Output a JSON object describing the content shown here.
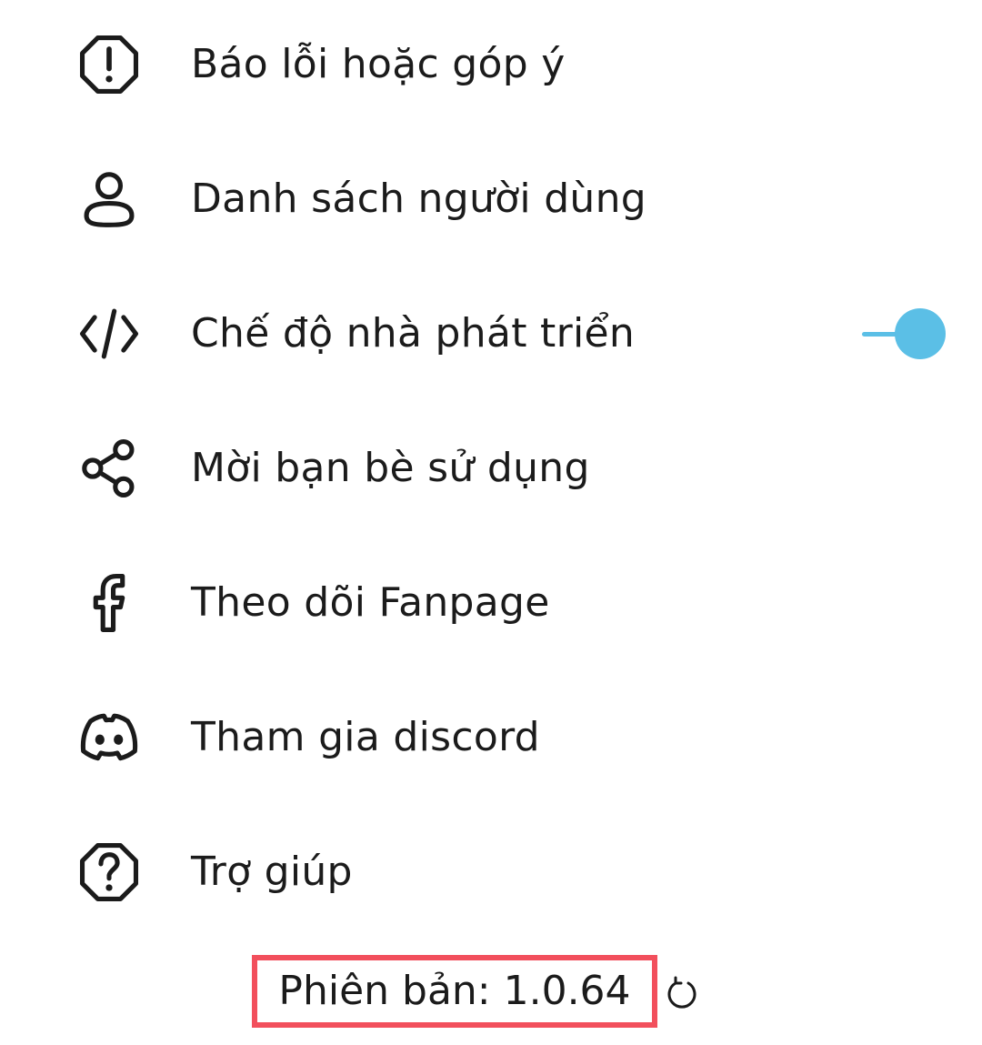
{
  "menu": {
    "items": [
      {
        "label": "Báo lỗi hoặc góp ý",
        "icon": "report-issue-icon"
      },
      {
        "label": "Danh sách người dùng",
        "icon": "user-icon"
      },
      {
        "label": "Chế độ nhà phát triển",
        "icon": "code-icon",
        "toggle_on": true
      },
      {
        "label": "Mời bạn bè sử dụng",
        "icon": "share-icon"
      },
      {
        "label": "Theo dõi Fanpage",
        "icon": "facebook-icon"
      },
      {
        "label": "Tham gia discord",
        "icon": "discord-icon"
      },
      {
        "label": "Trợ giúp",
        "icon": "help-icon"
      }
    ]
  },
  "footer": {
    "version_text": "Phiên bản: 1.0.64",
    "refresh_icon": "refresh-icon"
  },
  "colors": {
    "text": "#1b1b1b",
    "toggle_accent": "#5bbfe6",
    "highlight_border": "#f24f5c"
  }
}
